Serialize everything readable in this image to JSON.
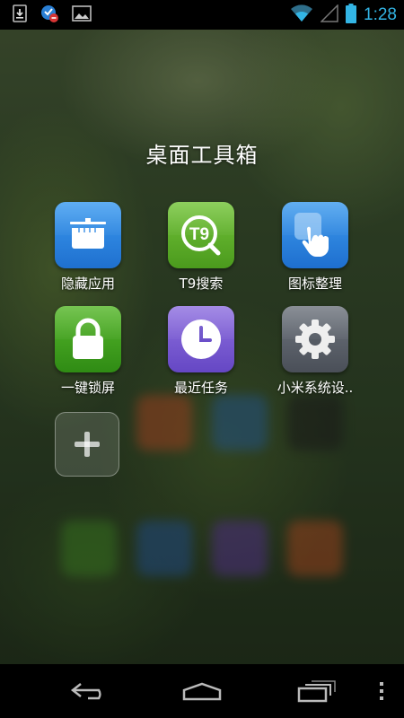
{
  "status_bar": {
    "time": "1:28",
    "left_icons": [
      "download-icon",
      "shield-alert-icon",
      "image-icon"
    ],
    "right_icons": [
      "wifi-icon",
      "signal-icon",
      "battery-icon"
    ],
    "accent": "#33b5e5"
  },
  "folder": {
    "title": "桌面工具箱",
    "apps": [
      {
        "label": "隐藏应用",
        "icon": "hidden-apps-icon",
        "color": "#2d86e0"
      },
      {
        "label": "T9搜索",
        "icon": "t9-search-icon",
        "color": "#5fae2a"
      },
      {
        "label": "图标整理",
        "icon": "icon-arrange-icon",
        "color": "#2a86df"
      },
      {
        "label": "一键锁屏",
        "icon": "lock-icon",
        "color": "#3fa51d"
      },
      {
        "label": "最近任务",
        "icon": "clock-icon",
        "color": "#7b5bd1"
      },
      {
        "label": "小米系统设..",
        "icon": "settings-gear-icon",
        "color": "#5c6270"
      }
    ],
    "add_button": "plus-icon"
  },
  "nav_bar": {
    "buttons": [
      "back-icon",
      "home-icon",
      "recent-apps-icon",
      "overflow-menu-icon"
    ]
  }
}
